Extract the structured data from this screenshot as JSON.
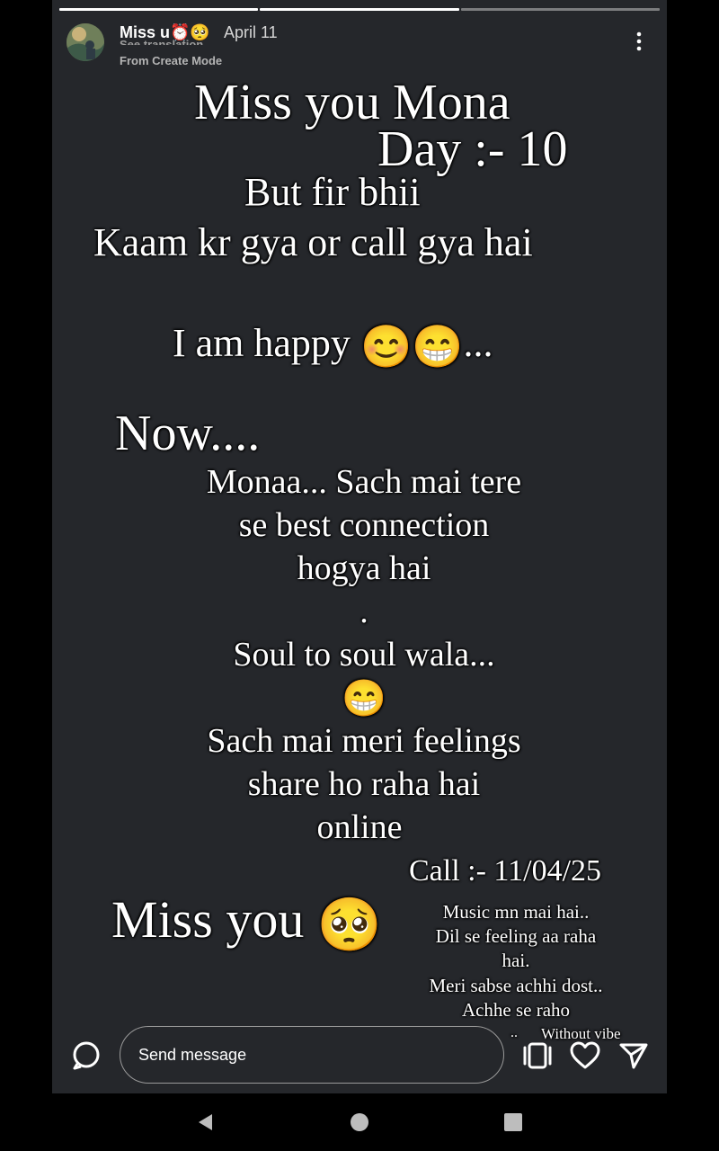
{
  "story": {
    "progress_segments": 3,
    "progress_active": 2,
    "header": {
      "username": "Miss u⏰🥺",
      "date": "April 11",
      "see_translation": "See translation",
      "from_mode": "From Create Mode"
    },
    "lines": {
      "title": "Miss you Mona",
      "day": "Day :- 10",
      "but": "But fir bhii",
      "kaam": "Kaam kr gya or call gya hai",
      "happy": "I am happy",
      "happy_emoji": "😊😁",
      "happy_dots": "...",
      "now": "Now....",
      "monaa": "Monaa... Sach mai tere",
      "best": "se best connection",
      "hogya": "hogya hai",
      "dot": ".",
      "soul": "Soul to soul wala...",
      "grin": "😁",
      "sach": "Sach mai meri feelings",
      "share": "share ho raha hai",
      "online": "online",
      "call": "Call :- 11/04/25",
      "miss_you": "Miss you",
      "pleading": "🥺",
      "music": "Music mn mai hai..",
      "dil": "Dil se feeling aa raha",
      "hai": "hai.",
      "meri": "Meri sabse achhi dost..",
      "achhe": "Achhe se raho",
      "ddots": "..",
      "without": "Without vibe"
    },
    "footer": {
      "send_placeholder": "Send message",
      "icons": [
        "camera-search-icon",
        "mention-reshare-icon",
        "heart-icon",
        "send-icon"
      ]
    }
  },
  "nav": {
    "icons": [
      "back-icon",
      "home-icon",
      "recents-icon"
    ]
  },
  "colors": {
    "story_bg": "#25272b",
    "text": "#ffffff",
    "page_bg": "#000000"
  }
}
